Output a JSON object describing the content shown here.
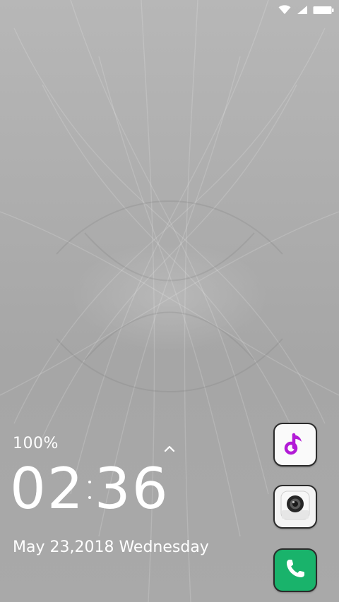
{
  "status_bar": {
    "wifi_icon": "wifi-icon",
    "signal_icon": "cell-signal-icon",
    "battery_icon": "battery-icon"
  },
  "lock_screen": {
    "battery_percent": "100%",
    "clock": {
      "hours": "02",
      "minutes": "36"
    },
    "date": "May 23,2018 Wednesday"
  },
  "shortcuts": [
    {
      "name": "music",
      "icon": "music-note-icon",
      "color": "#b21bd6"
    },
    {
      "name": "camera",
      "icon": "camera-icon",
      "color": "#3a3a3a"
    },
    {
      "name": "phone",
      "icon": "phone-icon",
      "color": "#19b36b"
    }
  ],
  "colors": {
    "text": "#ffffff",
    "wallpaper": "#a9a9a9"
  }
}
